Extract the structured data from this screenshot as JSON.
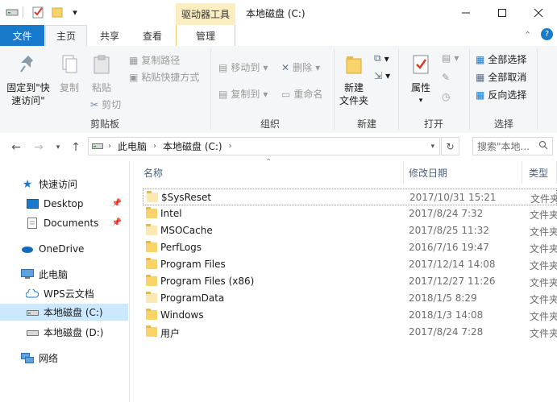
{
  "titlebar": {
    "context_tool_label": "驱动器工具",
    "window_title": "本地磁盘 (C:)",
    "quick_access_dropdown": "▾"
  },
  "tabs": {
    "file": "文件",
    "home": "主页",
    "share": "共享",
    "view": "查看",
    "manage": "管理"
  },
  "ribbon": {
    "pin_label_1": "固定到\"快",
    "pin_label_2": "速访问\"",
    "copy": "复制",
    "paste": "粘贴",
    "copy_path": "复制路径",
    "paste_shortcut": "粘贴快捷方式",
    "cut": "剪切",
    "clipboard_group": "剪贴板",
    "move_to": "移动到",
    "copy_to": "复制到",
    "delete": "删除",
    "rename": "重命名",
    "organize_group": "组织",
    "new_folder_1": "新建",
    "new_folder_2": "文件夹",
    "new_group": "新建",
    "properties": "属性",
    "open_group": "打开",
    "select_all": "全部选择",
    "select_none": "全部取消",
    "invert_selection": "反向选择",
    "select_group": "选择"
  },
  "address": {
    "crumb_pc": "此电脑",
    "crumb_drive": "本地磁盘 (C:)",
    "search_placeholder": "搜索\"本地..."
  },
  "navpane": {
    "quick_access": "快速访问",
    "desktop": "Desktop",
    "documents": "Documents",
    "onedrive": "OneDrive",
    "this_pc": "此电脑",
    "wps": "WPS云文档",
    "drive_c": "本地磁盘 (C:)",
    "drive_d": "本地磁盘 (D:)",
    "network": "网络"
  },
  "columns": {
    "name": "名称",
    "date": "修改日期",
    "type": "类型"
  },
  "files": [
    {
      "name": "$SysReset",
      "date": "2017/10/31 15:21",
      "type": "文件夹"
    },
    {
      "name": "Intel",
      "date": "2017/8/24 7:32",
      "type": "文件夹"
    },
    {
      "name": "MSOCache",
      "date": "2017/8/25 11:32",
      "type": "文件夹"
    },
    {
      "name": "PerfLogs",
      "date": "2016/7/16 19:47",
      "type": "文件夹"
    },
    {
      "name": "Program Files",
      "date": "2017/12/14 14:08",
      "type": "文件夹"
    },
    {
      "name": "Program Files (x86)",
      "date": "2017/12/27 11:26",
      "type": "文件夹"
    },
    {
      "name": "ProgramData",
      "date": "2018/1/5 8:29",
      "type": "文件夹"
    },
    {
      "name": "Windows",
      "date": "2018/1/3 14:08",
      "type": "文件夹"
    },
    {
      "name": "用户",
      "date": "2017/8/24 7:28",
      "type": "文件夹"
    }
  ],
  "colors": {
    "accent": "#1979ca",
    "context_tab": "#fbeec0",
    "folder": "#f7d36a",
    "selected_nav": "#cce8ff"
  }
}
